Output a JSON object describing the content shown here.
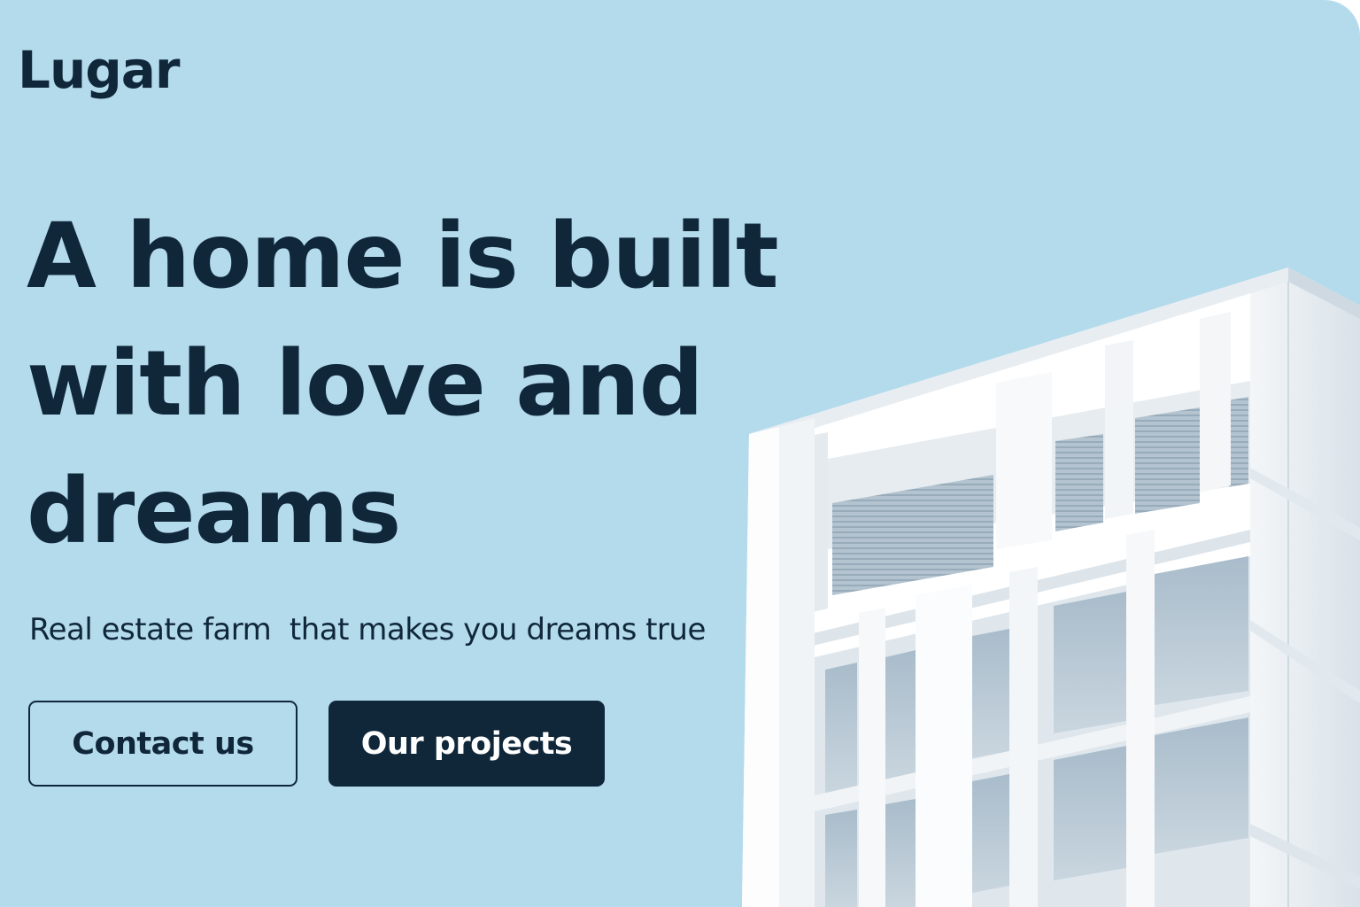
{
  "brand": {
    "name": "Lugar"
  },
  "hero": {
    "headline": "A home is built with love and dreams",
    "subtitle": "Real estate farm  that makes you dreams true"
  },
  "actions": {
    "contact_label": "Contact us",
    "projects_label": "Our projects"
  },
  "colors": {
    "background": "#b4dbec",
    "text": "#10273a",
    "primary_button": "#10273a",
    "primary_button_text": "#ffffff"
  },
  "image": {
    "icon": "building-photo"
  }
}
